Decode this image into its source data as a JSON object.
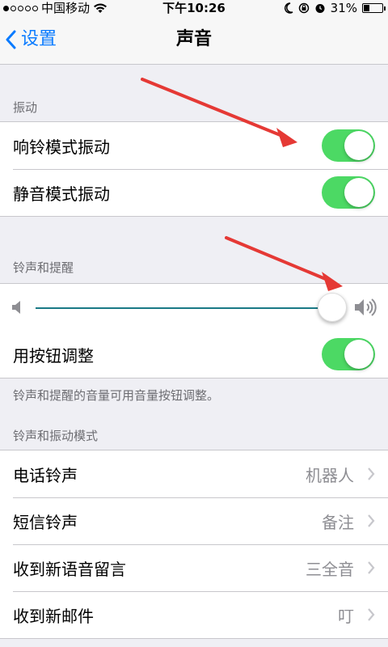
{
  "status_bar": {
    "carrier": "中国移动",
    "time": "下午10:26",
    "battery": "31%",
    "battery_level": 0.31
  },
  "nav": {
    "back_label": "设置",
    "title": "声音"
  },
  "vibrate": {
    "header": "振动",
    "items": [
      {
        "label": "响铃模式振动",
        "on": true
      },
      {
        "label": "静音模式振动",
        "on": true
      }
    ]
  },
  "ringer": {
    "header": "铃声和提醒",
    "volume_level": 0.97,
    "change_with_buttons_label": "用按钮调整",
    "change_with_buttons_on": true,
    "footer": "铃声和提醒的音量可用音量按钮调整。"
  },
  "patterns": {
    "header": "铃声和振动模式",
    "items": [
      {
        "label": "电话铃声",
        "value": "机器人"
      },
      {
        "label": "短信铃声",
        "value": "备注"
      },
      {
        "label": "收到新语音留言",
        "value": "三全音"
      },
      {
        "label": "收到新邮件",
        "value": "叮"
      }
    ]
  },
  "colors": {
    "toggle_on": "#4cd964",
    "accent": "#0a7bff",
    "annotation_arrow": "#e53935"
  },
  "icons": [
    "wifi-icon",
    "moon-icon",
    "rotation-lock-icon",
    "alarm-icon",
    "battery-icon",
    "back-chevron-icon",
    "speaker-low-icon",
    "speaker-high-icon",
    "chevron-right-icon"
  ]
}
